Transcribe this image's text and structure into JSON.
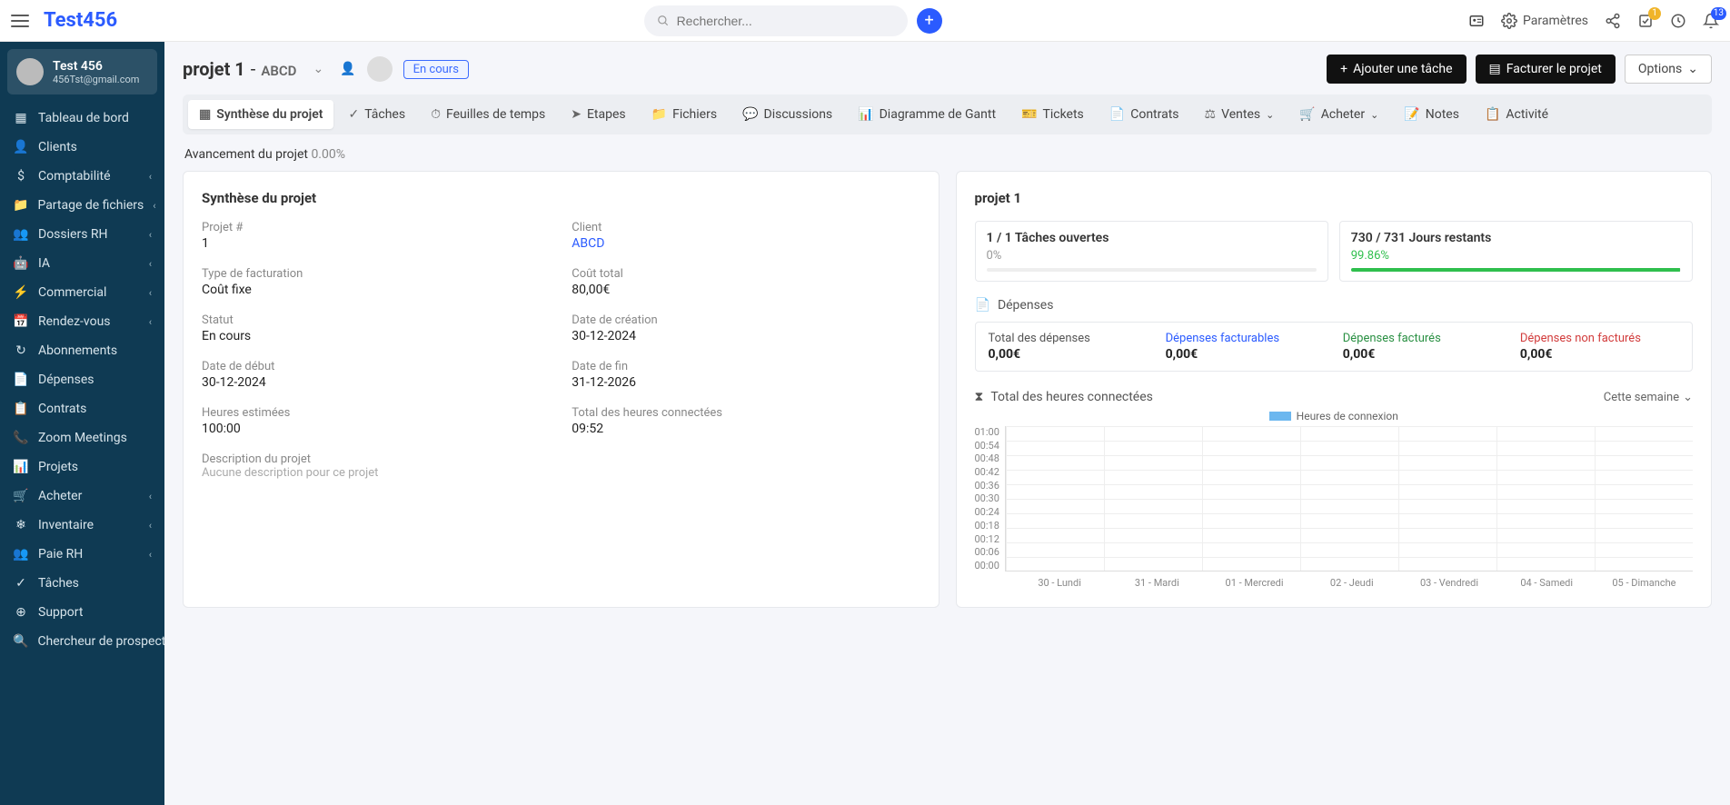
{
  "brand": "Test456",
  "search_placeholder": "Rechercher...",
  "topbar": {
    "settings_label": "Paramètres",
    "check_badge": "1",
    "bell_badge": "13"
  },
  "user": {
    "name": "Test 456",
    "email": "456Tst@gmail.com"
  },
  "sidebar": {
    "items": [
      {
        "label": "Tableau de bord",
        "icon": "▦",
        "expandable": false
      },
      {
        "label": "Clients",
        "icon": "👤",
        "expandable": false
      },
      {
        "label": "Comptabilité",
        "icon": "$",
        "expandable": true
      },
      {
        "label": "Partage de fichiers",
        "icon": "📁",
        "expandable": true
      },
      {
        "label": "Dossiers RH",
        "icon": "👥",
        "expandable": true
      },
      {
        "label": "IA",
        "icon": "🤖",
        "expandable": true
      },
      {
        "label": "Commercial",
        "icon": "⚡",
        "expandable": true
      },
      {
        "label": "Rendez-vous",
        "icon": "📅",
        "expandable": true
      },
      {
        "label": "Abonnements",
        "icon": "↻",
        "expandable": false
      },
      {
        "label": "Dépenses",
        "icon": "📄",
        "expandable": false
      },
      {
        "label": "Contrats",
        "icon": "📋",
        "expandable": false
      },
      {
        "label": "Zoom Meetings",
        "icon": "📞",
        "expandable": false
      },
      {
        "label": "Projets",
        "icon": "📊",
        "expandable": false
      },
      {
        "label": "Acheter",
        "icon": "🛒",
        "expandable": true
      },
      {
        "label": "Inventaire",
        "icon": "❄",
        "expandable": true
      },
      {
        "label": "Paie RH",
        "icon": "👥",
        "expandable": true
      },
      {
        "label": "Tâches",
        "icon": "✓",
        "expandable": false
      },
      {
        "label": "Support",
        "icon": "⊕",
        "expandable": false
      },
      {
        "label": "Chercheur de prospects",
        "icon": "🔍",
        "expandable": false
      }
    ]
  },
  "project": {
    "name": "projet 1",
    "client": "ABCD",
    "status_label": "En cours",
    "add_task": "Ajouter une tâche",
    "invoice_project": "Facturer le projet",
    "options": "Options"
  },
  "tabs": [
    {
      "label": "Synthèse du projet",
      "icon": "▦",
      "active": true
    },
    {
      "label": "Tâches",
      "icon": "✓"
    },
    {
      "label": "Feuilles de temps",
      "icon": "⏱"
    },
    {
      "label": "Etapes",
      "icon": "➤"
    },
    {
      "label": "Fichiers",
      "icon": "📁"
    },
    {
      "label": "Discussions",
      "icon": "💬"
    },
    {
      "label": "Diagramme de Gantt",
      "icon": "📊"
    },
    {
      "label": "Tickets",
      "icon": "🎫"
    },
    {
      "label": "Contrats",
      "icon": "📄"
    },
    {
      "label": "Ventes",
      "icon": "⚖",
      "drop": true
    },
    {
      "label": "Acheter",
      "icon": "🛒",
      "drop": true
    },
    {
      "label": "Notes",
      "icon": "📝"
    },
    {
      "label": "Activité",
      "icon": "📋"
    }
  ],
  "progress": {
    "label": "Avancement du projet",
    "pct": "0.00%"
  },
  "summary": {
    "title": "Synthèse du projet",
    "fields": {
      "project_num_l": "Projet #",
      "project_num_v": "1",
      "client_l": "Client",
      "client_v": "ABCD",
      "billing_l": "Type de facturation",
      "billing_v": "Coût fixe",
      "cost_l": "Coût total",
      "cost_v": "80,00€",
      "status_l": "Statut",
      "status_v": "En cours",
      "created_l": "Date de création",
      "created_v": "30-12-2024",
      "start_l": "Date de début",
      "start_v": "30-12-2024",
      "end_l": "Date de fin",
      "end_v": "31-12-2026",
      "est_l": "Heures estimées",
      "est_v": "100:00",
      "logged_l": "Total des heures connectées",
      "logged_v": "09:52"
    },
    "desc_l": "Description du projet",
    "desc_empty": "Aucune description pour ce projet"
  },
  "right": {
    "title": "projet 1",
    "tasks": {
      "label": "1 / 1 Tâches ouvertes",
      "pct": "0%",
      "fill": 0
    },
    "days": {
      "label": "730 / 731 Jours restants",
      "pct": "99.86%",
      "fill": 99.86
    },
    "expenses_title": "Dépenses",
    "expenses": {
      "total_l": "Total des dépenses",
      "total_v": "0,00€",
      "billable_l": "Dépenses facturables",
      "billable_v": "0,00€",
      "billed_l": "Dépenses facturés",
      "billed_v": "0,00€",
      "unbilled_l": "Dépenses non facturés",
      "unbilled_v": "0,00€"
    },
    "hours_title": "Total des heures connectées",
    "period": "Cette semaine",
    "legend": "Heures de connexion"
  },
  "chart_data": {
    "type": "bar",
    "categories": [
      "30 - Lundi",
      "31 - Mardi",
      "01 - Mercredi",
      "02 - Jeudi",
      "03 - Vendredi",
      "04 - Samedi",
      "05 - Dimanche"
    ],
    "values": [
      0,
      0,
      0,
      0,
      0,
      0,
      0
    ],
    "yticks": [
      "01:00",
      "00:54",
      "00:48",
      "00:42",
      "00:36",
      "00:30",
      "00:24",
      "00:18",
      "00:12",
      "00:06",
      "00:00"
    ],
    "ylabel": "",
    "xlabel": "",
    "title": "",
    "ylim": [
      0,
      60
    ]
  }
}
